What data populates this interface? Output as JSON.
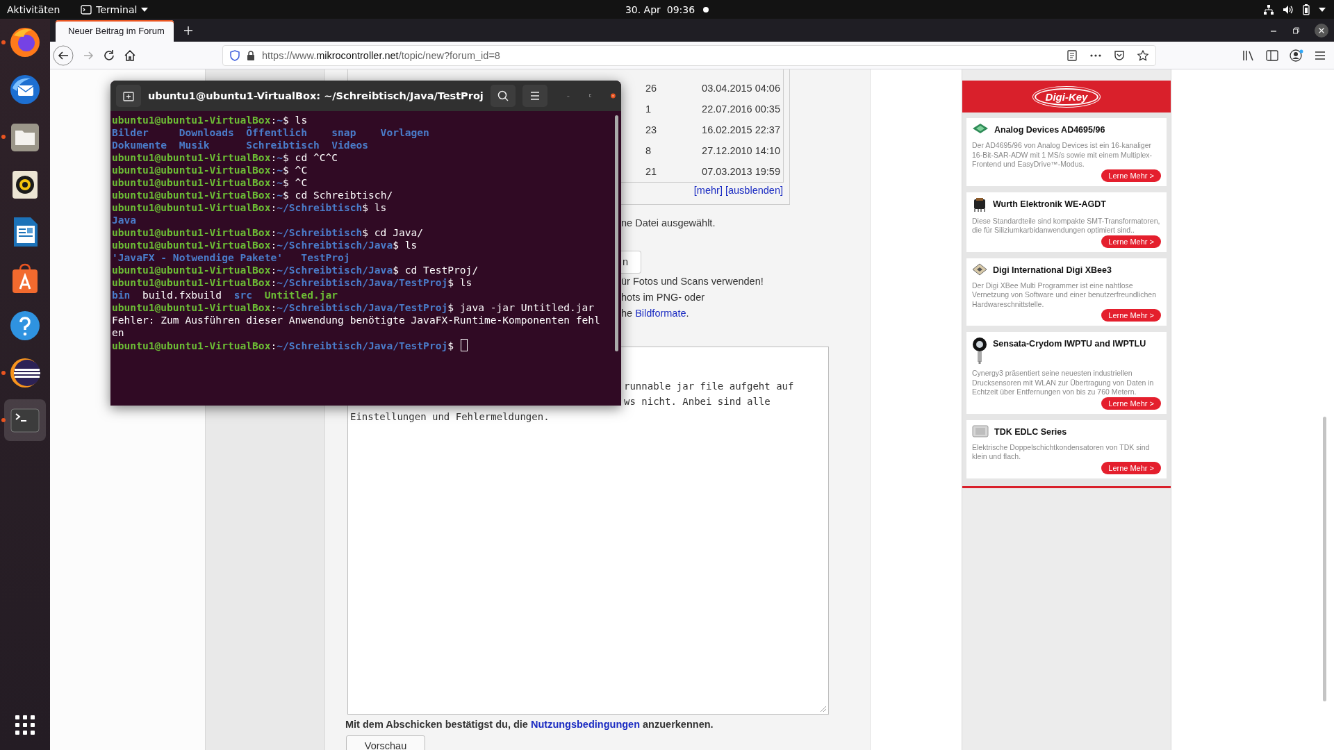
{
  "top_bar": {
    "activities": "Aktivitäten",
    "app_menu": "Terminal",
    "clock": "30. Apr  09:36"
  },
  "dock": [
    {
      "kind": "browser",
      "running": true,
      "focused": false
    },
    {
      "kind": "mail",
      "running": false,
      "focused": false
    },
    {
      "kind": "files",
      "running": true,
      "focused": false
    },
    {
      "kind": "music",
      "running": false,
      "focused": false
    },
    {
      "kind": "writer",
      "running": false,
      "focused": false
    },
    {
      "kind": "store",
      "running": false,
      "focused": false
    },
    {
      "kind": "help",
      "running": false,
      "focused": false
    },
    {
      "kind": "ide",
      "running": true,
      "focused": false
    },
    {
      "kind": "terminal",
      "running": true,
      "focused": true
    }
  ],
  "browser": {
    "tabs": [
      {
        "title": "Neuer Beitrag im Forum",
        "selected": true
      }
    ],
    "url": {
      "prefix": "https://www.",
      "domain": "mikrocontroller.net",
      "path": "/topic/new?forum_id=8"
    }
  },
  "page": {
    "topic_table": {
      "rows": [
        {
          "count": "26",
          "date": "03.04.2015 04:06"
        },
        {
          "count": "1",
          "date": "22.07.2016 00:35"
        },
        {
          "count": "23",
          "date": "16.02.2015 22:37"
        },
        {
          "count": "8",
          "date": "27.12.2010 14:10"
        },
        {
          "count": "21",
          "date": "07.03.2013 19:59"
        }
      ],
      "links": [
        "[mehr]",
        "[ausblenden]"
      ]
    },
    "upload": {
      "file_status": "ne Datei ausgewählt.",
      "button_fragment": "n",
      "hint_lines": [
        {
          "text": "ür Fotos und Scans verwenden!"
        },
        {
          "text": "hots im PNG- oder"
        },
        {
          "text": "he ",
          "link": "Bildformate",
          "after": "."
        }
      ]
    },
    "message": {
      "lines": [
        {
          "kind": "partial",
          "text": "runnable jar file aufgeht auf"
        },
        {
          "kind": "partial",
          "text": "ws nicht. Anbei sind alle"
        },
        {
          "kind": "full",
          "text": "Einstellungen und Fehlermeldungen."
        }
      ]
    },
    "terms": {
      "before": "Mit dem Abschicken bestätigst du, die ",
      "link": "Nutzungsbedingungen",
      "after": " anzuerkennen."
    },
    "preview_button": "Vorschau"
  },
  "sidebar": {
    "logo": "Digi-Key",
    "cards": [
      {
        "kind": "board",
        "title": "Analog Devices AD4695/96",
        "text": "Der AD4695/96 von Analog Devices ist ein 16-kanaliger 16-Bit-SAR-ADW mit 1 MS/s sowie mit einem Multiplex-Frontend und EasyDrive™-Modus.",
        "button": "Lerne Mehr >"
      },
      {
        "kind": "transformer",
        "title": "Wurth Elektronik WE-AGDT",
        "text": "Diese Standardteile sind kompakte SMT-Transformatoren, die für Siliziumkarbidanwendungen optimiert sind..",
        "button": "Lerne Mehr >"
      },
      {
        "kind": "module",
        "title": "Digi International Digi XBee3",
        "text": "Der Digi XBee Multi Programmer ist eine nahtlose Vernetzung von Software und einer benutzerfreundlichen Hardwareschnittstelle.",
        "button": "Lerne Mehr >"
      },
      {
        "kind": "sensor",
        "title": "Sensata-Crydom IWPTU and IWPTLU",
        "text": "Cynergy3 präsentiert seine neuesten industriellen Drucksensoren mit WLAN zur Übertragung von Daten in Echtzeit über Entfernungen von bis zu 760 Metern.",
        "button": "Lerne Mehr >"
      },
      {
        "kind": "capacitor",
        "title": "TDK EDLC Series",
        "text": "Elektrische Doppelschichtkondensatoren von TDK sind klein und flach.",
        "button": "Lerne Mehr >"
      }
    ]
  },
  "terminal": {
    "title": "ubuntu1@ubuntu1-VirtualBox: ~/Schreibtisch/Java/TestProj",
    "cursor": true,
    "lines": [
      {
        "spans": [
          {
            "kind": "user",
            "text": "ubuntu1@ubuntu1-VirtualBox"
          },
          {
            "kind": "plain",
            "text": ":"
          },
          {
            "kind": "path",
            "text": "~"
          },
          {
            "kind": "plain",
            "text": "$ ls"
          }
        ]
      },
      {
        "spans": [
          {
            "kind": "dir",
            "text": "Bilder     Downloads  Öffentlich    snap    Vorlagen"
          }
        ]
      },
      {
        "spans": [
          {
            "kind": "dir",
            "text": "Dokumente  Musik      Schreibtisch  Videos"
          }
        ]
      },
      {
        "spans": [
          {
            "kind": "user",
            "text": "ubuntu1@ubuntu1-VirtualBox"
          },
          {
            "kind": "plain",
            "text": ":"
          },
          {
            "kind": "path",
            "text": "~"
          },
          {
            "kind": "plain",
            "text": "$ cd ^C^C"
          }
        ]
      },
      {
        "spans": [
          {
            "kind": "user",
            "text": "ubuntu1@ubuntu1-VirtualBox"
          },
          {
            "kind": "plain",
            "text": ":"
          },
          {
            "kind": "path",
            "text": "~"
          },
          {
            "kind": "plain",
            "text": "$ ^C"
          }
        ]
      },
      {
        "spans": [
          {
            "kind": "user",
            "text": "ubuntu1@ubuntu1-VirtualBox"
          },
          {
            "kind": "plain",
            "text": ":"
          },
          {
            "kind": "path",
            "text": "~"
          },
          {
            "kind": "plain",
            "text": "$ ^C"
          }
        ]
      },
      {
        "spans": [
          {
            "kind": "user",
            "text": "ubuntu1@ubuntu1-VirtualBox"
          },
          {
            "kind": "plain",
            "text": ":"
          },
          {
            "kind": "path",
            "text": "~"
          },
          {
            "kind": "plain",
            "text": "$ cd Schreibtisch/"
          }
        ]
      },
      {
        "spans": [
          {
            "kind": "user",
            "text": "ubuntu1@ubuntu1-VirtualBox"
          },
          {
            "kind": "plain",
            "text": ":"
          },
          {
            "kind": "path",
            "text": "~/Schreibtisch"
          },
          {
            "kind": "plain",
            "text": "$ ls"
          }
        ]
      },
      {
        "spans": [
          {
            "kind": "dir",
            "text": "Java"
          }
        ]
      },
      {
        "spans": [
          {
            "kind": "user",
            "text": "ubuntu1@ubuntu1-VirtualBox"
          },
          {
            "kind": "plain",
            "text": ":"
          },
          {
            "kind": "path",
            "text": "~/Schreibtisch"
          },
          {
            "kind": "plain",
            "text": "$ cd Java/"
          }
        ]
      },
      {
        "spans": [
          {
            "kind": "user",
            "text": "ubuntu1@ubuntu1-VirtualBox"
          },
          {
            "kind": "plain",
            "text": ":"
          },
          {
            "kind": "path",
            "text": "~/Schreibtisch/Java"
          },
          {
            "kind": "plain",
            "text": "$ ls"
          }
        ]
      },
      {
        "spans": [
          {
            "kind": "dir",
            "text": "'JavaFX - Notwendige Pakete'   TestProj"
          }
        ]
      },
      {
        "spans": [
          {
            "kind": "user",
            "text": "ubuntu1@ubuntu1-VirtualBox"
          },
          {
            "kind": "plain",
            "text": ":"
          },
          {
            "kind": "path",
            "text": "~/Schreibtisch/Java"
          },
          {
            "kind": "plain",
            "text": "$ cd TestProj/"
          }
        ]
      },
      {
        "spans": [
          {
            "kind": "user",
            "text": "ubuntu1@ubuntu1-VirtualBox"
          },
          {
            "kind": "plain",
            "text": ":"
          },
          {
            "kind": "path",
            "text": "~/Schreibtisch/Java/TestProj"
          },
          {
            "kind": "plain",
            "text": "$ ls"
          }
        ]
      },
      {
        "spans": [
          {
            "kind": "dir",
            "text": "bin"
          },
          {
            "kind": "plain",
            "text": "  build.fxbuild  "
          },
          {
            "kind": "dir",
            "text": "src"
          },
          {
            "kind": "exec",
            "text": "Untitled.jar"
          }
        ]
      },
      {
        "spans": [
          {
            "kind": "user",
            "text": "ubuntu1@ubuntu1-VirtualBox"
          },
          {
            "kind": "plain",
            "text": ":"
          },
          {
            "kind": "path",
            "text": "~/Schreibtisch/Java/TestProj"
          },
          {
            "kind": "plain",
            "text": "$ java -jar Untitled.jar"
          }
        ]
      },
      {
        "spans": [
          {
            "kind": "plain",
            "text": "Fehler: Zum Ausführen dieser Anwendung benötigte JavaFX-Runtime-Komponenten fehl"
          }
        ]
      },
      {
        "spans": [
          {
            "kind": "plain",
            "text": "en"
          }
        ]
      },
      {
        "spans": [
          {
            "kind": "user",
            "text": "ubuntu1@ubuntu1-VirtualBox"
          },
          {
            "kind": "plain",
            "text": ":"
          },
          {
            "kind": "path",
            "text": "~/Schreibtisch/Java/TestProj"
          },
          {
            "kind": "plain",
            "text": "$ "
          }
        ]
      }
    ]
  }
}
